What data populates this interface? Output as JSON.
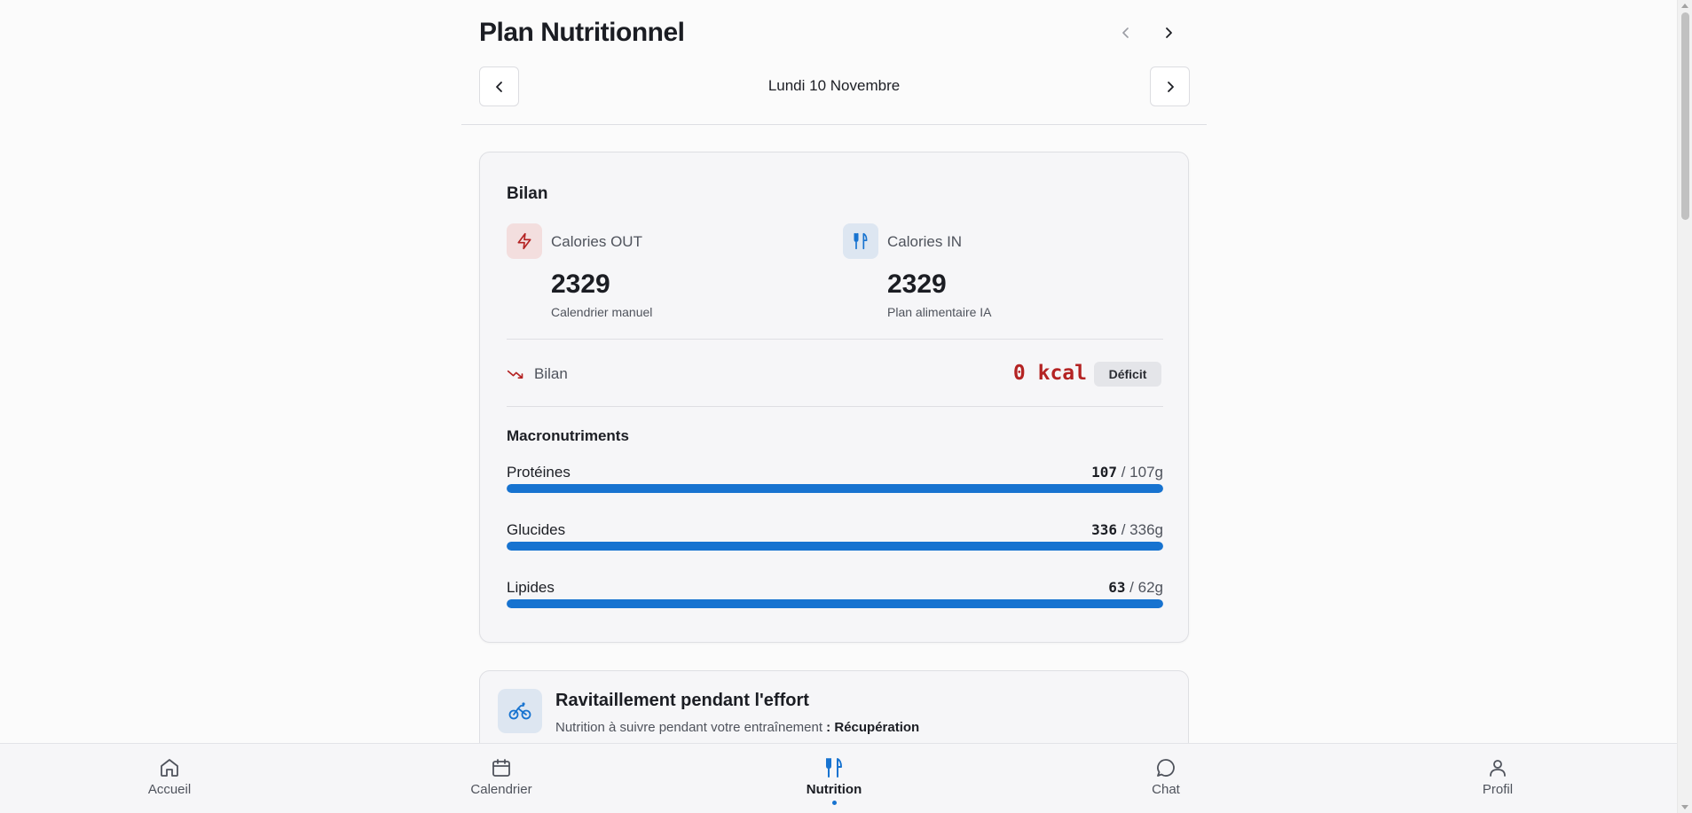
{
  "header": {
    "title": "Plan Nutritionnel",
    "date": "Lundi 10 Novembre"
  },
  "summary": {
    "title": "Bilan",
    "calories_out": {
      "label": "Calories OUT",
      "value": "2329",
      "source": "Calendrier manuel"
    },
    "calories_in": {
      "label": "Calories IN",
      "value": "2329",
      "source": "Plan alimentaire IA"
    },
    "balance": {
      "label": "Bilan",
      "value": "0 kcal",
      "badge": "Déficit"
    },
    "macros_title": "Macronutriments",
    "macros": [
      {
        "name": "Protéines",
        "current": "107",
        "target": " / 107g",
        "progress": 1.0
      },
      {
        "name": "Glucides",
        "current": "336",
        "target": " / 336g",
        "progress": 1.0
      },
      {
        "name": "Lipides",
        "current": "63",
        "target": " / 62g",
        "progress": 1.0
      }
    ]
  },
  "effort": {
    "title": "Ravitaillement pendant l'effort",
    "subtitle": "Nutrition à suivre pendant votre entraînement",
    "subtitle_sep": " : ",
    "type": "Récupération"
  },
  "nav": {
    "items": [
      {
        "label": "Accueil",
        "icon": "home-icon"
      },
      {
        "label": "Calendrier",
        "icon": "calendar-icon"
      },
      {
        "label": "Nutrition",
        "icon": "utensils-icon",
        "active": true
      },
      {
        "label": "Chat",
        "icon": "chat-icon"
      },
      {
        "label": "Profil",
        "icon": "user-icon"
      }
    ]
  },
  "colors": {
    "accent": "#1773d0",
    "deficit_red": "#b42323",
    "out_icon_bg": "#f3dede",
    "in_icon_bg": "#dde6f1"
  }
}
